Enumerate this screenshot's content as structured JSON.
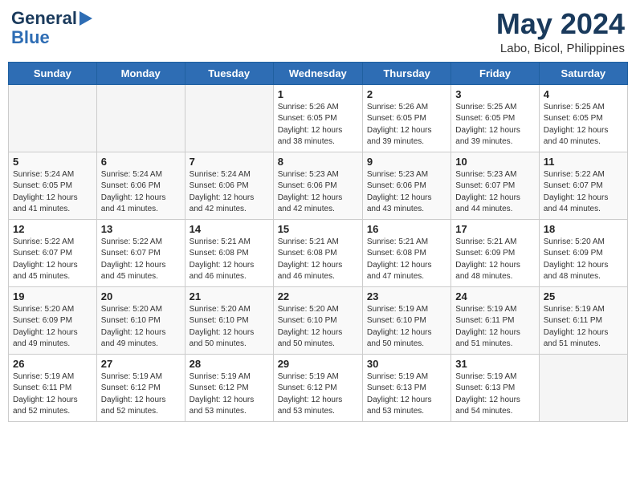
{
  "header": {
    "logo_line1": "General",
    "logo_line2": "Blue",
    "month_year": "May 2024",
    "location": "Labo, Bicol, Philippines"
  },
  "days_of_week": [
    "Sunday",
    "Monday",
    "Tuesday",
    "Wednesday",
    "Thursday",
    "Friday",
    "Saturday"
  ],
  "weeks": [
    [
      {
        "day": "",
        "info": ""
      },
      {
        "day": "",
        "info": ""
      },
      {
        "day": "",
        "info": ""
      },
      {
        "day": "1",
        "info": "Sunrise: 5:26 AM\nSunset: 6:05 PM\nDaylight: 12 hours\nand 38 minutes."
      },
      {
        "day": "2",
        "info": "Sunrise: 5:26 AM\nSunset: 6:05 PM\nDaylight: 12 hours\nand 39 minutes."
      },
      {
        "day": "3",
        "info": "Sunrise: 5:25 AM\nSunset: 6:05 PM\nDaylight: 12 hours\nand 39 minutes."
      },
      {
        "day": "4",
        "info": "Sunrise: 5:25 AM\nSunset: 6:05 PM\nDaylight: 12 hours\nand 40 minutes."
      }
    ],
    [
      {
        "day": "5",
        "info": "Sunrise: 5:24 AM\nSunset: 6:05 PM\nDaylight: 12 hours\nand 41 minutes."
      },
      {
        "day": "6",
        "info": "Sunrise: 5:24 AM\nSunset: 6:06 PM\nDaylight: 12 hours\nand 41 minutes."
      },
      {
        "day": "7",
        "info": "Sunrise: 5:24 AM\nSunset: 6:06 PM\nDaylight: 12 hours\nand 42 minutes."
      },
      {
        "day": "8",
        "info": "Sunrise: 5:23 AM\nSunset: 6:06 PM\nDaylight: 12 hours\nand 42 minutes."
      },
      {
        "day": "9",
        "info": "Sunrise: 5:23 AM\nSunset: 6:06 PM\nDaylight: 12 hours\nand 43 minutes."
      },
      {
        "day": "10",
        "info": "Sunrise: 5:23 AM\nSunset: 6:07 PM\nDaylight: 12 hours\nand 44 minutes."
      },
      {
        "day": "11",
        "info": "Sunrise: 5:22 AM\nSunset: 6:07 PM\nDaylight: 12 hours\nand 44 minutes."
      }
    ],
    [
      {
        "day": "12",
        "info": "Sunrise: 5:22 AM\nSunset: 6:07 PM\nDaylight: 12 hours\nand 45 minutes."
      },
      {
        "day": "13",
        "info": "Sunrise: 5:22 AM\nSunset: 6:07 PM\nDaylight: 12 hours\nand 45 minutes."
      },
      {
        "day": "14",
        "info": "Sunrise: 5:21 AM\nSunset: 6:08 PM\nDaylight: 12 hours\nand 46 minutes."
      },
      {
        "day": "15",
        "info": "Sunrise: 5:21 AM\nSunset: 6:08 PM\nDaylight: 12 hours\nand 46 minutes."
      },
      {
        "day": "16",
        "info": "Sunrise: 5:21 AM\nSunset: 6:08 PM\nDaylight: 12 hours\nand 47 minutes."
      },
      {
        "day": "17",
        "info": "Sunrise: 5:21 AM\nSunset: 6:09 PM\nDaylight: 12 hours\nand 48 minutes."
      },
      {
        "day": "18",
        "info": "Sunrise: 5:20 AM\nSunset: 6:09 PM\nDaylight: 12 hours\nand 48 minutes."
      }
    ],
    [
      {
        "day": "19",
        "info": "Sunrise: 5:20 AM\nSunset: 6:09 PM\nDaylight: 12 hours\nand 49 minutes."
      },
      {
        "day": "20",
        "info": "Sunrise: 5:20 AM\nSunset: 6:10 PM\nDaylight: 12 hours\nand 49 minutes."
      },
      {
        "day": "21",
        "info": "Sunrise: 5:20 AM\nSunset: 6:10 PM\nDaylight: 12 hours\nand 50 minutes."
      },
      {
        "day": "22",
        "info": "Sunrise: 5:20 AM\nSunset: 6:10 PM\nDaylight: 12 hours\nand 50 minutes."
      },
      {
        "day": "23",
        "info": "Sunrise: 5:19 AM\nSunset: 6:10 PM\nDaylight: 12 hours\nand 50 minutes."
      },
      {
        "day": "24",
        "info": "Sunrise: 5:19 AM\nSunset: 6:11 PM\nDaylight: 12 hours\nand 51 minutes."
      },
      {
        "day": "25",
        "info": "Sunrise: 5:19 AM\nSunset: 6:11 PM\nDaylight: 12 hours\nand 51 minutes."
      }
    ],
    [
      {
        "day": "26",
        "info": "Sunrise: 5:19 AM\nSunset: 6:11 PM\nDaylight: 12 hours\nand 52 minutes."
      },
      {
        "day": "27",
        "info": "Sunrise: 5:19 AM\nSunset: 6:12 PM\nDaylight: 12 hours\nand 52 minutes."
      },
      {
        "day": "28",
        "info": "Sunrise: 5:19 AM\nSunset: 6:12 PM\nDaylight: 12 hours\nand 53 minutes."
      },
      {
        "day": "29",
        "info": "Sunrise: 5:19 AM\nSunset: 6:12 PM\nDaylight: 12 hours\nand 53 minutes."
      },
      {
        "day": "30",
        "info": "Sunrise: 5:19 AM\nSunset: 6:13 PM\nDaylight: 12 hours\nand 53 minutes."
      },
      {
        "day": "31",
        "info": "Sunrise: 5:19 AM\nSunset: 6:13 PM\nDaylight: 12 hours\nand 54 minutes."
      },
      {
        "day": "",
        "info": ""
      }
    ]
  ]
}
